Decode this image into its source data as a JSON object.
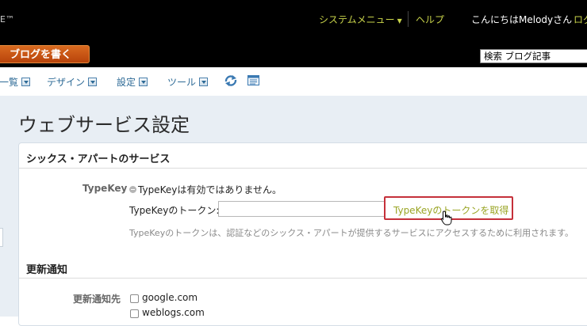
{
  "header": {
    "brand": "E™",
    "system_menu": "システムメニュー",
    "help": "ヘルプ",
    "greeting": "こんにちはMelodyさん",
    "logout": "ログ",
    "write_blog": "ブログを書く",
    "search_value": "検索 ブログ記事"
  },
  "menu": {
    "items": [
      {
        "label": "一覧"
      },
      {
        "label": "デザイン"
      },
      {
        "label": "設定"
      },
      {
        "label": "ツール"
      }
    ]
  },
  "page": {
    "title": "ウェブサービス設定"
  },
  "six_apart": {
    "title": "シックス・アパートのサービス",
    "typekey_label": "TypeKey",
    "typekey_status": "TypeKeyは有効ではありません。",
    "token_label": "TypeKeyのトークン:",
    "token_value": "",
    "get_token_button": "TypeKeyのトークンを取得",
    "token_hint": "TypeKeyのトークンは、認証などのシックス・アパートが提供するサービスにアクセスするために利用されます。"
  },
  "update_ping": {
    "title": "更新通知",
    "label": "更新通知先",
    "targets": [
      {
        "name": "google.com",
        "checked": false
      },
      {
        "name": "weblogs.com",
        "checked": false
      }
    ]
  },
  "colors": {
    "accent_link": "#c8d34a",
    "menu_text": "#2d6a96",
    "write_button": "#c9531a",
    "highlight_border": "#c5303a"
  }
}
